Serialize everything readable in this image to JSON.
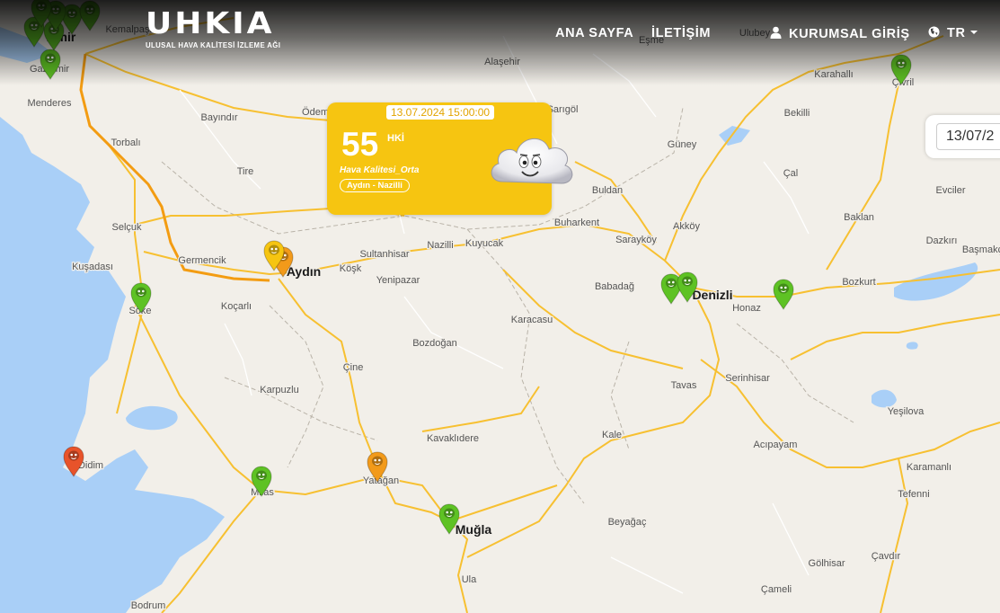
{
  "header": {
    "logo_text": "UHKIA",
    "logo_subtitle": "ULUSAL HAVA KALİTESİ İZLEME AĞI",
    "nav": {
      "home": "ANA SAYFA",
      "contact": "İLETİŞİM",
      "corporate_login": "KURUMSAL GİRİŞ",
      "language": "TR"
    }
  },
  "date_filter": {
    "value": "13/07/2"
  },
  "popup": {
    "datetime": "13.07.2024 15:00:00",
    "value": "55",
    "unit": "HKİ",
    "category": "Hava Kalitesi_Orta",
    "station": "Aydın - Nazilli",
    "icon": "smiling-cloud-icon"
  },
  "colors": {
    "good": "#5ec224",
    "moderate": "#f6c511",
    "sensitive": "#f29a1a",
    "unhealthy": "#e8532a",
    "road": "#f7c031",
    "motorway": "#f39c12",
    "water": "#a9cff7",
    "land": "#f2efe9"
  },
  "map": {
    "places": [
      {
        "name": "İzmir",
        "type": "city"
      },
      {
        "name": "Kemalpaşa",
        "type": "town"
      },
      {
        "name": "Gaziemir",
        "type": "town"
      },
      {
        "name": "Menderes",
        "type": "town"
      },
      {
        "name": "Bayındır",
        "type": "town"
      },
      {
        "name": "Torbalı",
        "type": "town"
      },
      {
        "name": "Ödemiş",
        "type": "town"
      },
      {
        "name": "Tire",
        "type": "town"
      },
      {
        "name": "Alaşehir",
        "type": "town"
      },
      {
        "name": "Eşme",
        "type": "town"
      },
      {
        "name": "Ulubey",
        "type": "town"
      },
      {
        "name": "Karahallı",
        "type": "town"
      },
      {
        "name": "Çivril",
        "type": "town"
      },
      {
        "name": "Güney",
        "type": "town"
      },
      {
        "name": "Bekilli",
        "type": "town"
      },
      {
        "name": "Sarıgöl",
        "type": "town"
      },
      {
        "name": "Buldan",
        "type": "town"
      },
      {
        "name": "Çal",
        "type": "town"
      },
      {
        "name": "Evciler",
        "type": "town"
      },
      {
        "name": "Baklan",
        "type": "town"
      },
      {
        "name": "Dazkırı",
        "type": "town"
      },
      {
        "name": "Başmakçı",
        "type": "town"
      },
      {
        "name": "Buharkent",
        "type": "town"
      },
      {
        "name": "Akköy",
        "type": "town"
      },
      {
        "name": "Sarayköy",
        "type": "town"
      },
      {
        "name": "Selçuk",
        "type": "town"
      },
      {
        "name": "Kuşadası",
        "type": "town"
      },
      {
        "name": "Germencik",
        "type": "town"
      },
      {
        "name": "Aydın",
        "type": "city"
      },
      {
        "name": "Köşk",
        "type": "town"
      },
      {
        "name": "Sultanhisar",
        "type": "town"
      },
      {
        "name": "Nazilli",
        "type": "town"
      },
      {
        "name": "Kuyucak",
        "type": "town"
      },
      {
        "name": "Yenipazar",
        "type": "town"
      },
      {
        "name": "Babadağ",
        "type": "town"
      },
      {
        "name": "Denizli",
        "type": "city"
      },
      {
        "name": "Honaz",
        "type": "town"
      },
      {
        "name": "Bozkurt",
        "type": "town"
      },
      {
        "name": "Söke",
        "type": "town"
      },
      {
        "name": "Koçarlı",
        "type": "town"
      },
      {
        "name": "Karacasu",
        "type": "town"
      },
      {
        "name": "Bozdoğan",
        "type": "town"
      },
      {
        "name": "Çine",
        "type": "town"
      },
      {
        "name": "Tavas",
        "type": "town"
      },
      {
        "name": "Serinhisar",
        "type": "town"
      },
      {
        "name": "Karpuzlu",
        "type": "town"
      },
      {
        "name": "Yeşilova",
        "type": "town"
      },
      {
        "name": "Kavaklıdere",
        "type": "town"
      },
      {
        "name": "Kale",
        "type": "town"
      },
      {
        "name": "Acıpayam",
        "type": "town"
      },
      {
        "name": "Didim",
        "type": "town"
      },
      {
        "name": "Milas",
        "type": "town"
      },
      {
        "name": "Yatağan",
        "type": "town"
      },
      {
        "name": "Karamanlı",
        "type": "town"
      },
      {
        "name": "Tefenni",
        "type": "town"
      },
      {
        "name": "Muğla",
        "type": "city"
      },
      {
        "name": "Beyağaç",
        "type": "town"
      },
      {
        "name": "Gölhisar",
        "type": "town"
      },
      {
        "name": "Çavdır",
        "type": "town"
      },
      {
        "name": "Ula",
        "type": "town"
      },
      {
        "name": "Çameli",
        "type": "town"
      },
      {
        "name": "Bodrum",
        "type": "town"
      }
    ],
    "markers": [
      {
        "status": "good"
      },
      {
        "status": "good"
      },
      {
        "status": "good"
      },
      {
        "status": "good"
      },
      {
        "status": "good"
      },
      {
        "status": "good"
      },
      {
        "status": "good"
      },
      {
        "status": "good"
      },
      {
        "status": "sensitive"
      },
      {
        "status": "moderate"
      },
      {
        "status": "good"
      },
      {
        "status": "good"
      },
      {
        "status": "good"
      },
      {
        "status": "good"
      },
      {
        "status": "unhealthy"
      },
      {
        "status": "good"
      },
      {
        "status": "sensitive"
      },
      {
        "status": "good"
      }
    ]
  }
}
